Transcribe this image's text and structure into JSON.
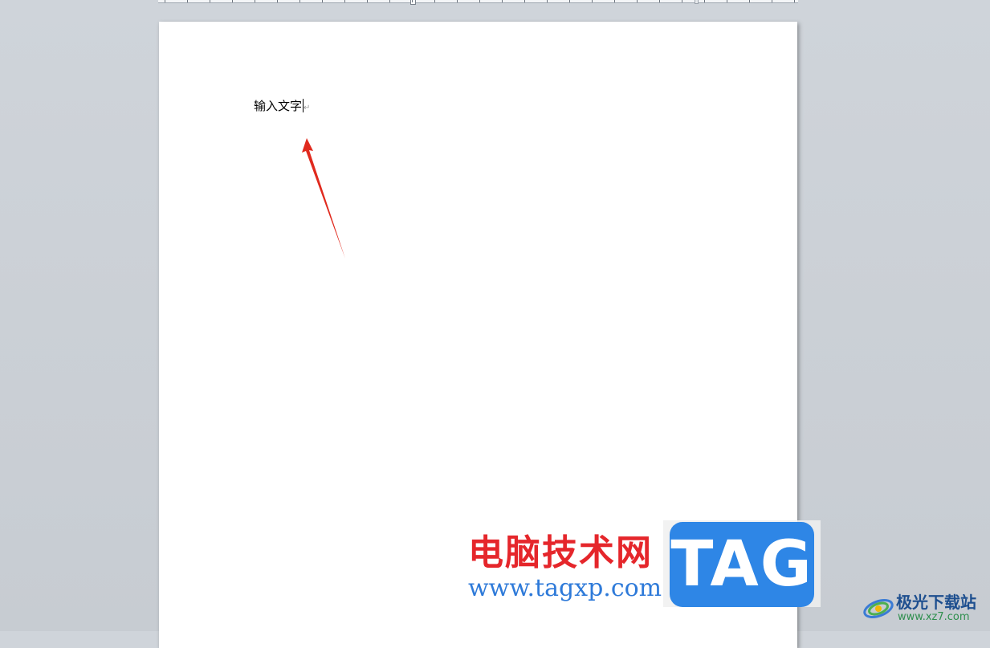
{
  "document": {
    "text": "输入文字",
    "paragraph_mark": "↵"
  },
  "watermark": {
    "site_name_cn": "电脑技术网",
    "site_url": "www.tagxp.com",
    "tag_text": "TAG"
  },
  "site_logo": {
    "name": "极光下载站",
    "url": "www.xz7.com"
  },
  "colors": {
    "arrow": "#e02a1e",
    "watermark_red": "#e5262b",
    "watermark_blue": "#2e86e6"
  }
}
